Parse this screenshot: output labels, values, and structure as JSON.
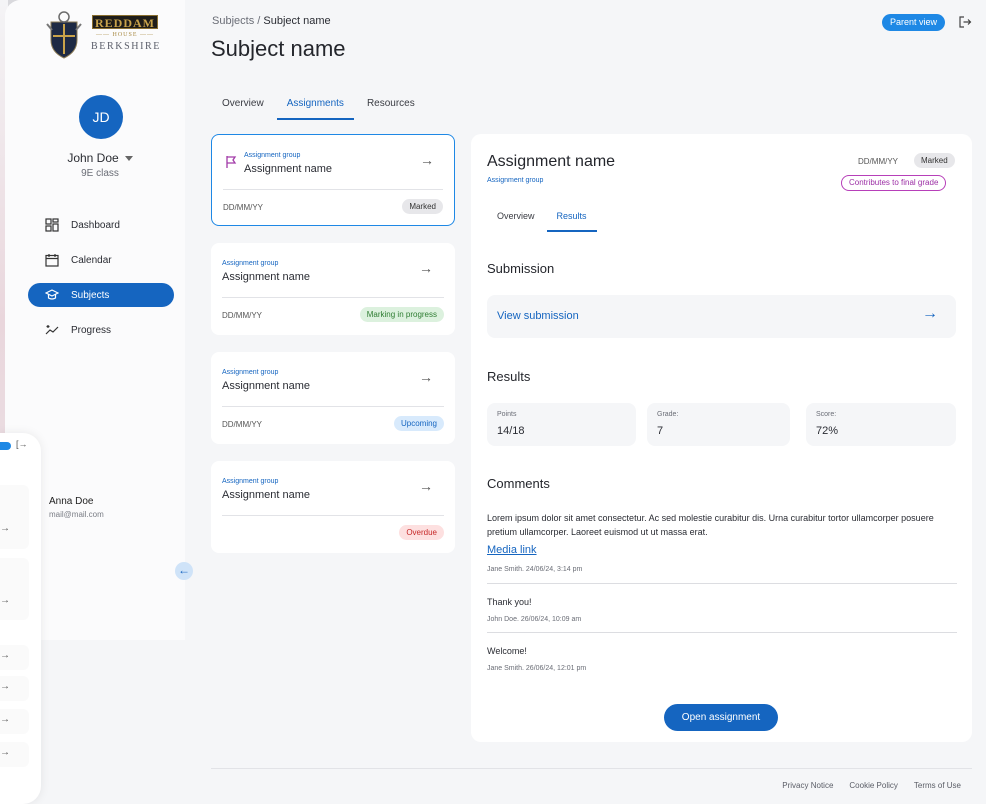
{
  "logo": {
    "top": "REDDAM",
    "middle": "HOUSE",
    "bottom": "BERKSHIRE"
  },
  "user": {
    "initials": "JD",
    "name": "John Doe",
    "class": "9E class"
  },
  "nav": [
    {
      "label": "Dashboard",
      "icon": "dashboard-icon"
    },
    {
      "label": "Calendar",
      "icon": "calendar-icon"
    },
    {
      "label": "Subjects",
      "icon": "graduation-cap-icon",
      "active": true
    },
    {
      "label": "Progress",
      "icon": "sparkle-chart-icon"
    }
  ],
  "overlay": {
    "name": "Anna Doe",
    "email": "mail@mail.com"
  },
  "breadcrumb": {
    "parent": "Subjects",
    "separator": "/",
    "current": "Subject name"
  },
  "page_title": "Subject name",
  "parent_view": "Parent view",
  "tabs": [
    "Overview",
    "Assignments",
    "Resources"
  ],
  "assignments": [
    {
      "group": "Assignment group",
      "name": "Assignment name",
      "date": "DD/MM/YY",
      "status": "Marked",
      "status_color": "#e7e7ea",
      "selected": true
    },
    {
      "group": "Assignment group",
      "name": "Assignment name",
      "date": "DD/MM/YY",
      "status": "Marking in progress",
      "status_color": "#dcf1de"
    },
    {
      "group": "Assignment group",
      "name": "Assignment name",
      "date": "DD/MM/YY",
      "status": "Upcoming",
      "status_color": "#d8eafc"
    },
    {
      "group": "Assignment group",
      "name": "Assignment name",
      "date": "",
      "status": "Overdue",
      "status_color": "#fde0e0"
    }
  ],
  "detail": {
    "title": "Assignment name",
    "group": "Assignment group",
    "date": "DD/MM/YY",
    "status": "Marked",
    "contributes": "Contributes to final grade",
    "tabs": [
      "Overview",
      "Results"
    ],
    "submission_heading": "Submission",
    "view_submission": "View submission",
    "results_heading": "Results",
    "results": [
      {
        "label": "Points",
        "value": "14/18"
      },
      {
        "label": "Grade:",
        "value": "7"
      },
      {
        "label": "Score:",
        "value": "72%"
      }
    ],
    "comments_heading": "Comments",
    "comment_text": "Lorem ipsum dolor sit amet consectetur. Ac sed molestie curabitur dis. Urna curabitur tortor ullamcorper posuere pretium ullamcorper. Laoreet euismod ut ut massa erat.",
    "media_link": "Media link",
    "comment1_meta": "Jane Smith. 24/06/24, 3:14 pm",
    "comment2_body": "Thank you!",
    "comment2_meta": "John Doe. 26/06/24, 10:09 am",
    "comment3_body": "Welcome!",
    "comment3_meta": "Jane Smith. 26/06/24, 12:01 pm",
    "open_button": "Open assignment"
  },
  "footer": [
    "Privacy Notice",
    "Cookie Policy",
    "Terms of Use"
  ],
  "colors": {
    "primary": "#1565c0",
    "accent": "#1e88e5",
    "contributes": "#b73fb9"
  }
}
